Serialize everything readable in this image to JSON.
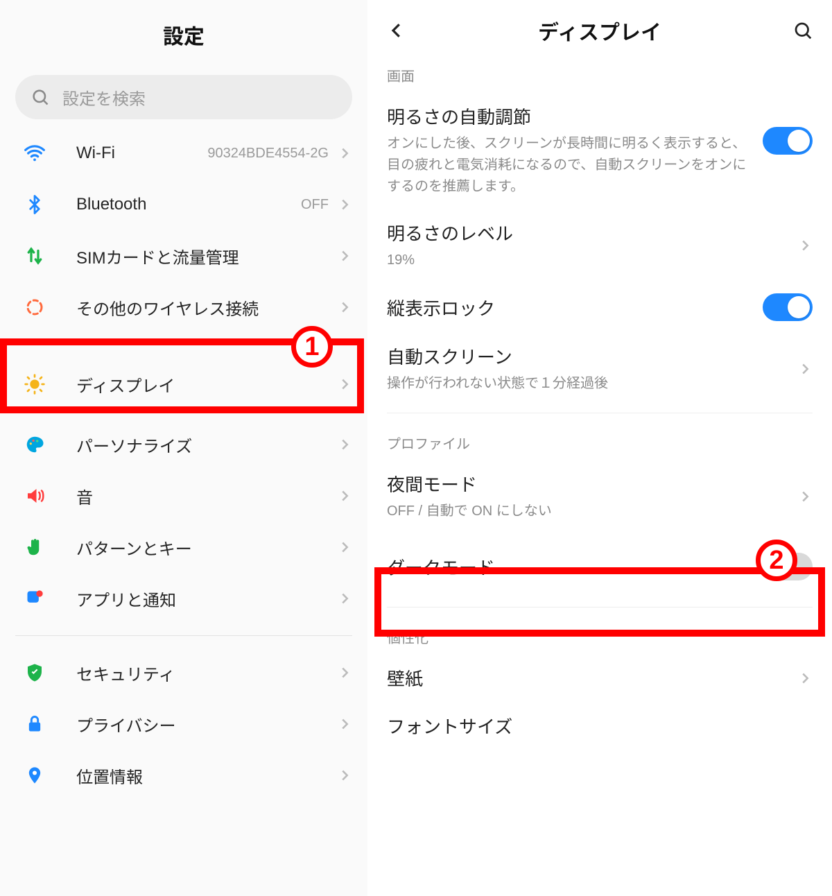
{
  "left": {
    "title": "設定",
    "search_placeholder": "設定を検索",
    "items": [
      {
        "icon": "wifi-icon",
        "label": "Wi-Fi",
        "value": "90324BDE4554-2G"
      },
      {
        "icon": "bluetooth-icon",
        "label": "Bluetooth",
        "value": "OFF"
      },
      {
        "icon": "sim-icon",
        "label": "SIMカードと流量管理",
        "value": ""
      },
      {
        "icon": "wireless-icon",
        "label": "その他のワイヤレス接続",
        "value": ""
      }
    ],
    "items2": [
      {
        "icon": "brightness-icon",
        "label": "ディスプレイ",
        "value": ""
      },
      {
        "icon": "palette-icon",
        "label": "パーソナライズ",
        "value": ""
      },
      {
        "icon": "volume-icon",
        "label": "音",
        "value": ""
      },
      {
        "icon": "hand-icon",
        "label": "パターンとキー",
        "value": ""
      },
      {
        "icon": "apps-icon",
        "label": "アプリと通知",
        "value": ""
      }
    ],
    "items3": [
      {
        "icon": "shield-icon",
        "label": "セキュリティ",
        "value": ""
      },
      {
        "icon": "lock-icon",
        "label": "プライバシー",
        "value": ""
      },
      {
        "icon": "location-icon",
        "label": "位置情報",
        "value": ""
      }
    ]
  },
  "right": {
    "title": "ディスプレイ",
    "section1": "画面",
    "auto_brightness_title": "明るさの自動調節",
    "auto_brightness_sub": "オンにした後、スクリーンが長時間に明るく表示すると、目の疲れと電気消耗になるので、自動スクリーンをオンにするのを推薦します。",
    "auto_brightness_on": true,
    "brightness_level_title": "明るさのレベル",
    "brightness_level_sub": "19%",
    "portrait_lock_title": "縦表示ロック",
    "portrait_lock_on": true,
    "auto_screen_title": "自動スクリーン",
    "auto_screen_sub": "操作が行われない状態で１分経過後",
    "section2": "プロファイル",
    "night_mode_title": "夜間モード",
    "night_mode_sub": "OFF / 自動で ON にしない",
    "dark_mode_title": "ダークモード",
    "dark_mode_on": false,
    "section3": "個性化",
    "wallpaper_title": "壁紙",
    "font_size_title": "フォントサイズ"
  },
  "annotations": {
    "badge1": "1",
    "badge2": "2"
  },
  "colors": {
    "accent": "#1e88ff",
    "highlight": "#ff0000",
    "wifi": "#1e88ff",
    "bluetooth": "#1e88ff",
    "sim": "#1db34a",
    "wireless": "#ff6a3d",
    "brightness": "#f5b41a",
    "palette": "#00a6e0",
    "volume": "#ff3c3c",
    "hand": "#1db34a",
    "apps": "#1e88ff",
    "shield": "#1db34a",
    "lock": "#1e88ff",
    "location": "#1e88ff"
  }
}
